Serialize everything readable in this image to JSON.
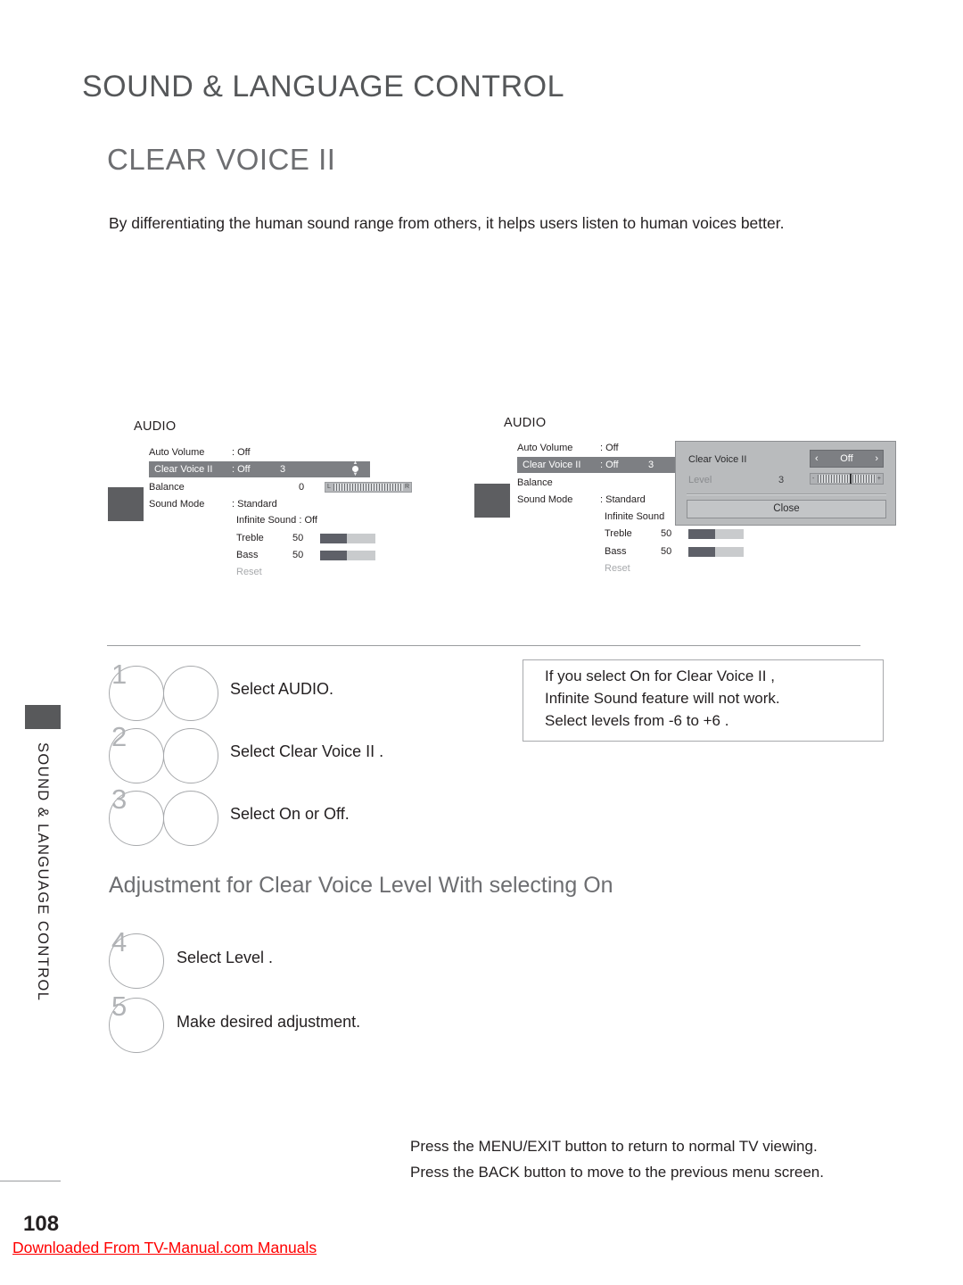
{
  "page": {
    "chapter_title": "SOUND & LANGUAGE CONTROL",
    "section_title": "CLEAR VOICE II",
    "intro": "By differentiating the human sound range from others, it helps users listen to human voices better.",
    "page_number": "108",
    "watermark": "Downloaded From TV-Manual.com Manuals"
  },
  "side_tab": {
    "label": "SOUND & LANGUAGE CONTROL"
  },
  "osd_left": {
    "title": "AUDIO",
    "rows": [
      {
        "label": "Auto Volume",
        "value": ": Off"
      },
      {
        "label": "Clear Voice II",
        "value": ": Off",
        "number": "3"
      },
      {
        "label": "Balance",
        "number": "0",
        "bar_left": "L",
        "bar_right": "R"
      },
      {
        "label": "Sound Mode",
        "value": ": Standard"
      },
      {
        "label": "Infinite Sound : Off"
      },
      {
        "label": "Treble",
        "number": "50"
      },
      {
        "label": "Bass",
        "number": "50"
      },
      {
        "label": "Reset"
      }
    ]
  },
  "osd_right": {
    "title": "AUDIO",
    "rows": [
      {
        "label": "Auto Volume",
        "value": ": Off"
      },
      {
        "label": "Clear Voice II",
        "value": ": Off",
        "number": "3"
      },
      {
        "label": "Balance"
      },
      {
        "label": "Sound Mode",
        "value": ": Standard"
      },
      {
        "label": "Infinite Sound"
      },
      {
        "label": "Treble",
        "number": "50"
      },
      {
        "label": "Bass",
        "number": "50"
      },
      {
        "label": "Reset"
      }
    ],
    "dialog": {
      "title": "Clear Voice II",
      "select_value": "Off",
      "arrow_left": "‹",
      "arrow_right": "›",
      "level_label": "Level",
      "level_value": "3",
      "slider_minus": "-",
      "slider_plus": "+",
      "close_label": "Close"
    }
  },
  "steps_primary": [
    {
      "number": "1",
      "text": "Select AUDIO."
    },
    {
      "number": "2",
      "text": "Select Clear Voice II ."
    },
    {
      "number": "3",
      "text": "Select On or Off."
    }
  ],
  "note": {
    "lines": [
      "If you select  On  for Clear Voice II ,",
      " Infinite Sound   feature will not work.",
      "Select levels from  -6  to  +6 ."
    ]
  },
  "sub_heading": "Adjustment for Clear Voice Level With selecting On",
  "steps_secondary": [
    {
      "number": "4",
      "text": "Select Level ."
    },
    {
      "number": "5",
      "text": "Make desired adjustment."
    }
  ],
  "footer": {
    "lines": [
      "Press the MENU/EXIT button to return to normal TV viewing.",
      "Press the BACK  button to move to the previous menu screen."
    ]
  }
}
